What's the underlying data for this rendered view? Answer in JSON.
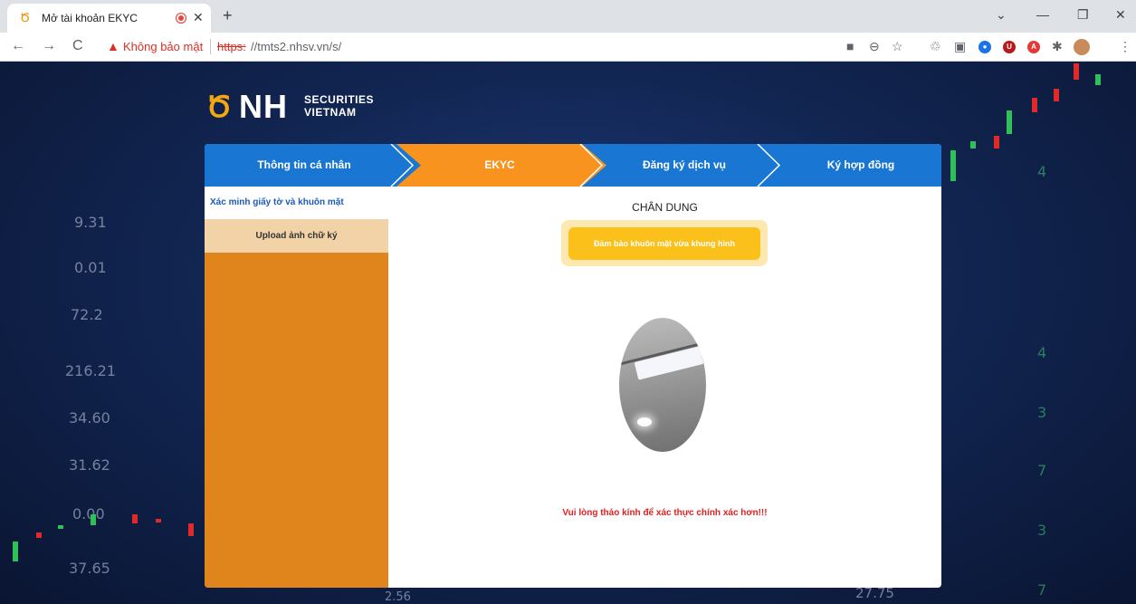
{
  "browser": {
    "tab_title": "Mở tài khoản EKYC",
    "tab_favicon": "nhsv-logo-icon",
    "new_tab_label": "+",
    "security_label": "Không bảo mật",
    "url_protocol": "https:",
    "url_rest": "//tmts2.nhsv.vn/s/",
    "extensions": [
      "camera-icon",
      "zoom-icon",
      "star-icon",
      "recycle-icon",
      "screenshot-icon",
      "chat-icon",
      "ublock-icon",
      "abp-icon",
      "puzzle-icon",
      "profile-avatar"
    ]
  },
  "background": {
    "left_numbers": [
      "9.31",
      "0.01",
      "72.2",
      "216.21",
      "34.60",
      "31.62",
      "0.00",
      "37.65"
    ],
    "right_numbers": [
      "4",
      "4",
      "3",
      "7",
      "3",
      "7"
    ],
    "bottom_numbers": [
      "2.56",
      "27.75"
    ]
  },
  "logo": {
    "mark": "Ծ",
    "name": "NH",
    "line1": "SECURITIES",
    "line2": "VIETNAM"
  },
  "steps": [
    {
      "label": "Thông tin cá nhân",
      "active": false
    },
    {
      "label": "EKYC",
      "active": true
    },
    {
      "label": "Đăng ký dịch vụ",
      "active": false
    },
    {
      "label": "Ký hợp đồng",
      "active": false
    }
  ],
  "sidebar": {
    "items": [
      {
        "label": "Xác minh giấy tờ và khuôn mặt",
        "active": true
      },
      {
        "label": "Upload ảnh chữ ký",
        "active": false
      }
    ]
  },
  "main": {
    "title": "CHÂN DUNG",
    "hint": "Đảm bảo khuôn mặt vừa khung hình",
    "warning": "Vui lòng tháo kính để xác thực chính xác hơn!!!"
  },
  "colors": {
    "step_blue": "#1976d2",
    "step_orange": "#f7931e",
    "sidebar_orange": "#e0841c",
    "hint_yellow": "#fbc11a",
    "warning_red": "#e02020"
  }
}
